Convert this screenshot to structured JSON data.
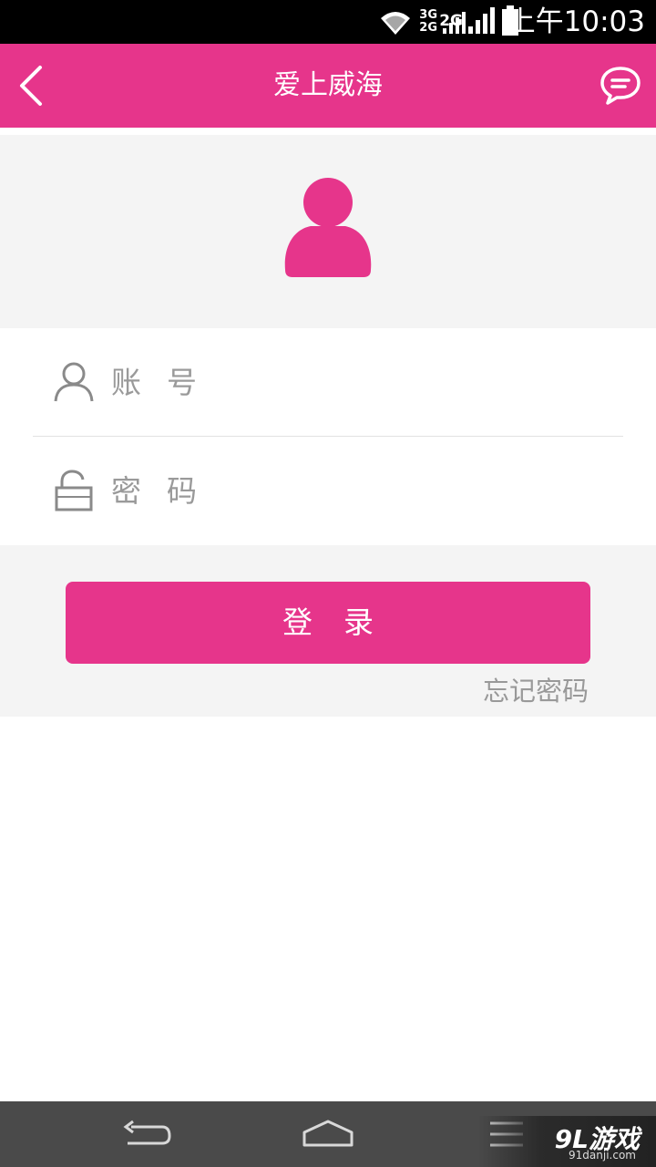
{
  "status_bar": {
    "net_top": "3G",
    "net_bottom": "2G",
    "net_second": "2G",
    "time": "上午10:03"
  },
  "app_bar": {
    "title": "爱上威海",
    "back_icon": "chevron-left-icon",
    "message_icon": "chat-bubble-icon"
  },
  "avatar": {
    "icon": "user-avatar-icon"
  },
  "form": {
    "account_placeholder": "账号",
    "password_placeholder": "密码"
  },
  "login": {
    "button_label": "登录",
    "forgot_label": "忘记密码"
  },
  "nav": {
    "back_icon": "back-arrow-icon",
    "home_icon": "home-icon",
    "menu_icon": "menu-icon"
  },
  "watermark": {
    "logo": "9L游戏",
    "url": "91danji.com"
  },
  "colors": {
    "accent": "#e6358b",
    "panel": "#f4f4f4",
    "navbar": "#4a4a4a"
  }
}
